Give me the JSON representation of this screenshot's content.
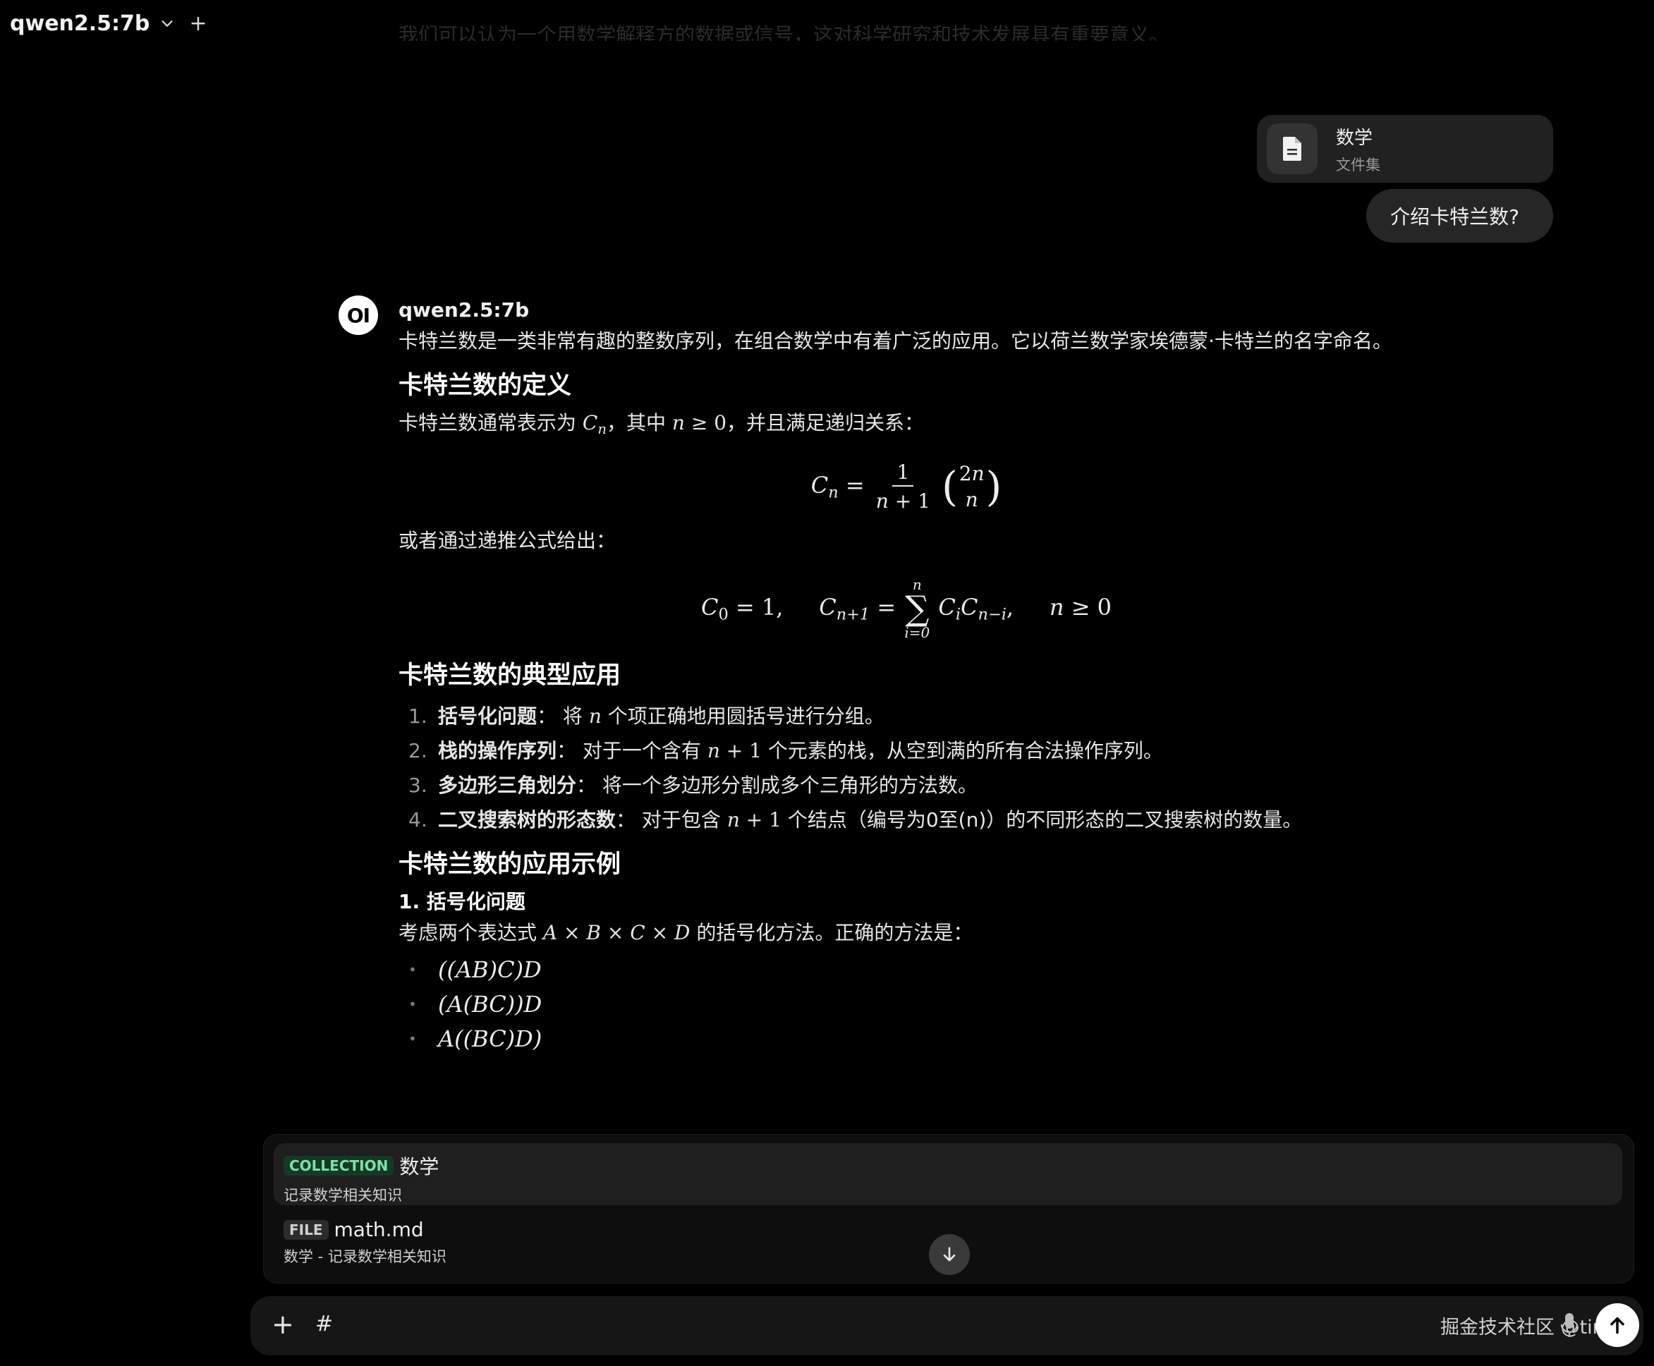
{
  "header": {
    "model": "qwen2.5:7b",
    "faded_text": "我们可以认为一个用数学解释方的数据或信号，这对科学研究和技术发展具有重要意义。"
  },
  "user_message": {
    "collection_title": "数学",
    "collection_subtitle": "文件集",
    "text": "介绍卡特兰数?"
  },
  "assistant": {
    "name": "qwen2.5:7b",
    "intro": "卡特兰数是一类非常有趣的整数序列，在组合数学中有着广泛的应用。它以荷兰数学家埃德蒙·卡特兰的名字命名。",
    "h_definition": "卡特兰数的定义",
    "def_prefix": "卡特兰数通常表示为 ",
    "def_mid": "，其中 ",
    "def_suffix": "，并且满足递归关系：",
    "recursive_intro": "或者通过递推公式给出：",
    "h_applications": "卡特兰数的典型应用",
    "applications": [
      {
        "num": "1.",
        "title": "括号化问题",
        "sep": "： ",
        "text_a": "将 ",
        "text_b": " 个项正确地用圆括号进行分组。"
      },
      {
        "num": "2.",
        "title": "栈的操作序列",
        "sep": "： ",
        "text_a": "对于一个含有 ",
        "text_b": " 个元素的栈，从空到满的所有合法操作序列。"
      },
      {
        "num": "3.",
        "title": "多边形三角划分",
        "sep": "： ",
        "text_a": "将一个多边形分割成多个三角形的方法数。",
        "text_b": ""
      },
      {
        "num": "4.",
        "title": "二叉搜索树的形态数",
        "sep": "： ",
        "text_a": "对于包含 ",
        "text_b": " 个结点（编号为0至(n)）的不同形态的二叉搜索树的数量。"
      }
    ],
    "h_examples": "卡特兰数的应用示例",
    "h3_example1": "1. 括号化问题",
    "example_prefix": "考虑两个表达式 ",
    "example_suffix": " 的括号化方法。正确的方法是：",
    "parenthesizations": [
      "((AB)C)D",
      "(A(BC))D",
      "A((BC)D)"
    ]
  },
  "suggestions": [
    {
      "badge": "COLLECTION",
      "title": "数学",
      "subtitle": "记录数学相关知识"
    },
    {
      "badge": "FILE",
      "title": "math.md",
      "subtitle": "数学 - 记录数学相关知识"
    }
  ],
  "input": {
    "value": "#",
    "watermark": "掘金技术社区 @tinker"
  },
  "icons": {
    "model_dropdown": "chevron-down-icon",
    "new_chat": "plus-icon",
    "collection": "document-icon",
    "scroll_down": "arrow-down-icon",
    "attach": "plus-icon",
    "mic": "microphone-icon",
    "send": "arrow-up-icon"
  }
}
